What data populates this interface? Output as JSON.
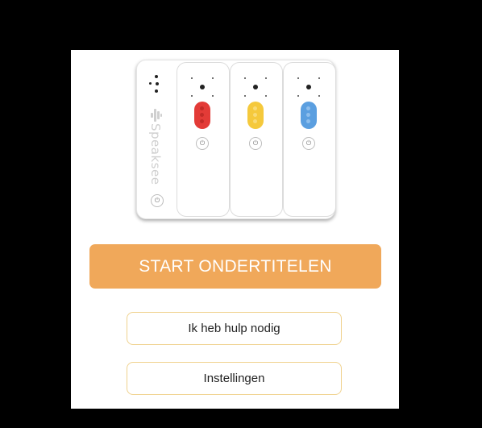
{
  "device": {
    "brand": "Speaksee",
    "mic_colors": [
      "#e33b37",
      "#f5c93c",
      "#5b9fe0"
    ]
  },
  "buttons": {
    "start_label": "START ONDERTITELEN",
    "help_label": "Ik heb hulp nodig",
    "settings_label": "Instellingen"
  },
  "colors": {
    "primary": "#f0a85a",
    "secondary_border": "#f0d28e"
  }
}
